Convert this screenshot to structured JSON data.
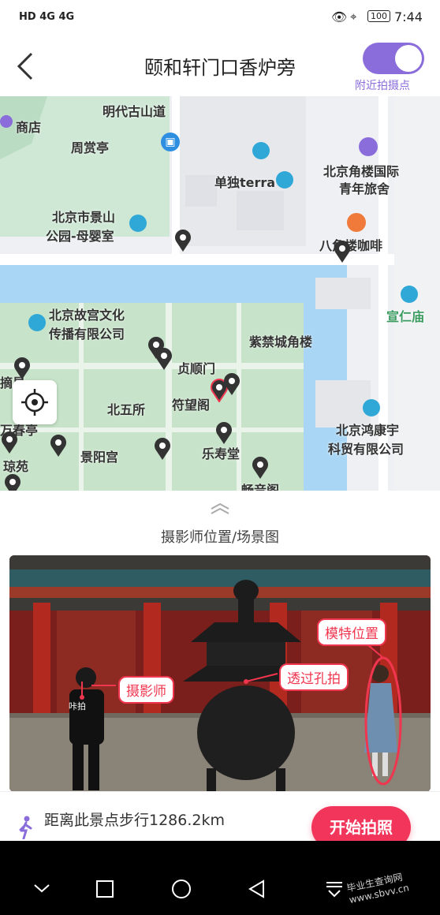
{
  "status_bar": {
    "left_icons": "HD 4G 4G",
    "battery": "100",
    "time": "7:44"
  },
  "header": {
    "title": "颐和轩门口香炉旁",
    "toggle_on": true,
    "nearby_label": "附近拍摄点"
  },
  "map": {
    "labels": [
      "明代古山道",
      "商店",
      "周赏亭",
      "单独terra",
      "北京角楼国际",
      "青年旅舍",
      "北京市景山",
      "公园-母婴室",
      "八角楼咖啡",
      "宣仁庙",
      "北京故宫文化",
      "传播有限公司",
      "紫禁城角楼",
      "贞顺门",
      "符望阁",
      "北五所",
      "景阳宫",
      "乐寿堂",
      "畅音阁",
      "北京鸿康宇",
      "科贸有限公司",
      "万春亭",
      "琼苑",
      "摘星"
    ]
  },
  "panel": {
    "title": "摄影师位置/场景图",
    "tags": {
      "photographer": "摄影师",
      "through_hole": "透过孔拍",
      "model_position": "模特位置"
    },
    "shirt_text": "咔拍"
  },
  "bottom": {
    "distance_text": "距离此景点步行1286.2km",
    "start_button": "开始拍照"
  },
  "watermark": "毕业生查询网 www.sbvv.cn"
}
